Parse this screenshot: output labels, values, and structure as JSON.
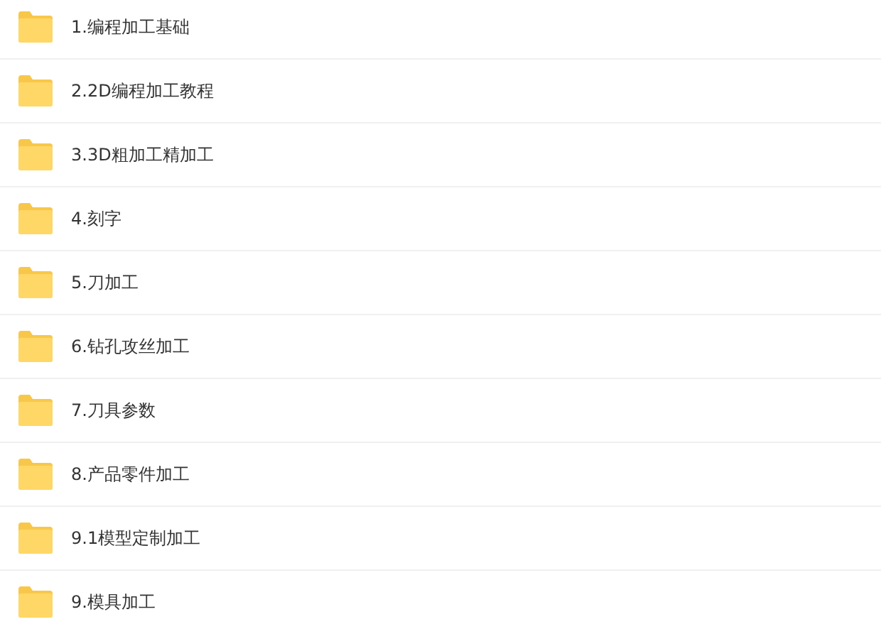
{
  "folders": [
    {
      "name": "1.编程加工基础"
    },
    {
      "name": "2.2D编程加工教程"
    },
    {
      "name": "3.3D粗加工精加工"
    },
    {
      "name": "4.刻字"
    },
    {
      "name": "5.刀加工"
    },
    {
      "name": "6.钻孔攻丝加工"
    },
    {
      "name": "7.刀具参数"
    },
    {
      "name": "8.产品零件加工"
    },
    {
      "name": "9.1模型定制加工"
    },
    {
      "name": "9.模具加工"
    }
  ]
}
